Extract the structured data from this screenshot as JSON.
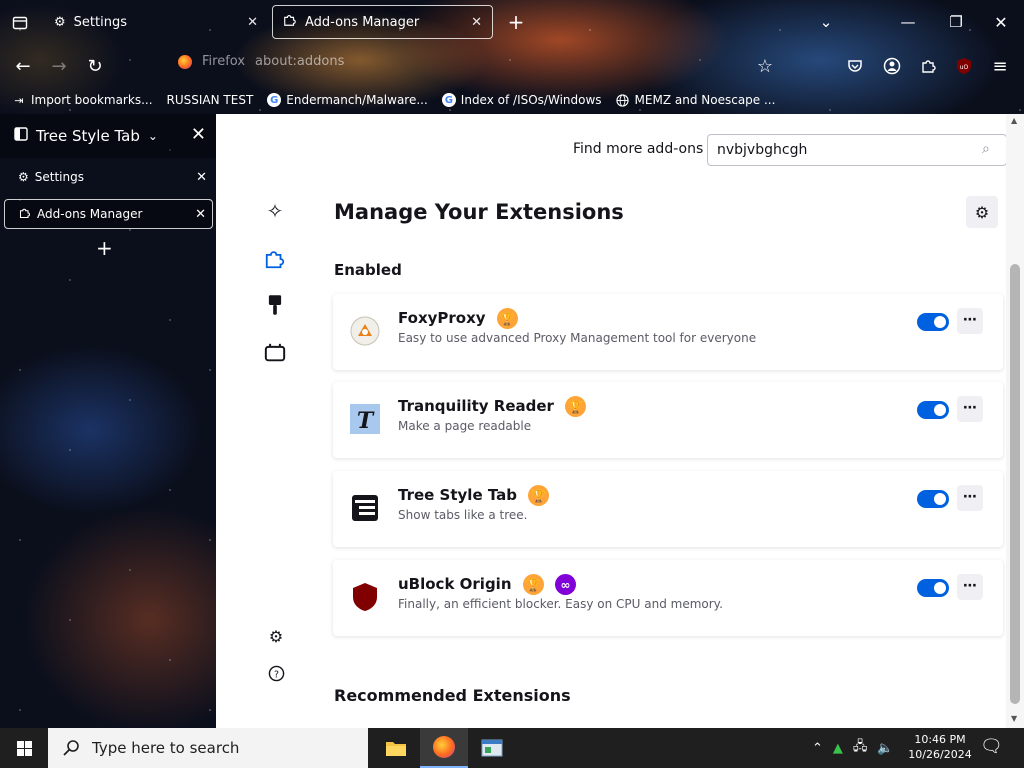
{
  "browser": {
    "tabs": [
      {
        "label": "Settings",
        "active": false
      },
      {
        "label": "Add-ons Manager",
        "active": true
      }
    ],
    "new_tab_glyph": "+",
    "address": {
      "identity": "Firefox",
      "url": "about:addons"
    },
    "bookmarks": [
      {
        "label": "Import bookmarks...",
        "icon": "import-icon"
      },
      {
        "label": "RUSSIAN TEST",
        "icon": "none"
      },
      {
        "label": "Endermanch/Malware...",
        "icon": "google-icon"
      },
      {
        "label": "Index of /ISOs/Windows",
        "icon": "google-icon"
      },
      {
        "label": "MEMZ and Noescape ...",
        "icon": "globe-icon"
      }
    ]
  },
  "sidebar": {
    "title": "Tree Style Tab",
    "tabs": [
      {
        "label": "Settings"
      },
      {
        "label": "Add-ons Manager"
      }
    ],
    "new_tab_glyph": "+"
  },
  "addons": {
    "find_label": "Find more add-ons",
    "search_value": "nvbjvbghcgh",
    "title": "Manage Your Extensions",
    "enabled_heading": "Enabled",
    "recommended_heading": "Recommended Extensions",
    "extensions": [
      {
        "name": "FoxyProxy",
        "description": "Easy to use advanced Proxy Management tool for everyone",
        "recommended": true,
        "private": false,
        "enabled": true
      },
      {
        "name": "Tranquility Reader",
        "description": "Make a page readable",
        "recommended": true,
        "private": false,
        "enabled": true
      },
      {
        "name": "Tree Style Tab",
        "description": "Show tabs like a tree.",
        "recommended": true,
        "private": false,
        "enabled": true
      },
      {
        "name": "uBlock Origin",
        "description": "Finally, an efficient blocker. Easy on CPU and memory.",
        "recommended": true,
        "private": true,
        "enabled": true
      }
    ],
    "more_glyph": "⋯"
  },
  "taskbar": {
    "search_placeholder": "Type here to search",
    "time": "10:46 PM",
    "date": "10/26/2024"
  },
  "colors": {
    "accent": "#0061e0",
    "recommended_badge": "#ffa436",
    "private_badge": "#8000d7",
    "taskbar": "#1f1f1f"
  }
}
